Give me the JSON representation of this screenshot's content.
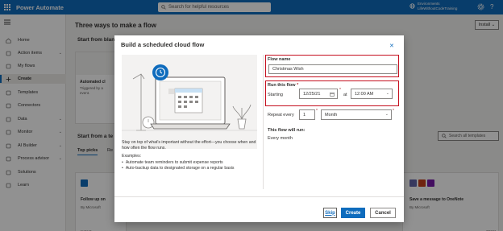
{
  "topbar": {
    "app_title": "Power Automate",
    "search_placeholder": "Search for helpful resources",
    "environment_label": "Environments",
    "environment_name": "LifeWithoutCodeTraining",
    "help": "?"
  },
  "sidebar": {
    "items": [
      {
        "label": "Home",
        "icon": "home-icon",
        "chevron": false
      },
      {
        "label": "Action items",
        "icon": "checklist-icon",
        "chevron": true
      },
      {
        "label": "My flows",
        "icon": "flows-icon",
        "chevron": false
      },
      {
        "label": "Create",
        "icon": "plus-icon",
        "chevron": false
      },
      {
        "label": "Templates",
        "icon": "templates-icon",
        "chevron": false
      },
      {
        "label": "Connectors",
        "icon": "connectors-icon",
        "chevron": false
      },
      {
        "label": "Data",
        "icon": "data-icon",
        "chevron": true
      },
      {
        "label": "Monitor",
        "icon": "monitor-icon",
        "chevron": true
      },
      {
        "label": "AI Builder",
        "icon": "ai-builder-icon",
        "chevron": true
      },
      {
        "label": "Process advisor",
        "icon": "process-advisor-icon",
        "chevron": true
      },
      {
        "label": "Solutions",
        "icon": "solutions-icon",
        "chevron": false
      },
      {
        "label": "Learn",
        "icon": "learn-icon",
        "chevron": false
      }
    ],
    "active_index": 3
  },
  "main": {
    "title": "Three ways to make a flow",
    "install_label": "Install",
    "start_blank_label": "Start from blan",
    "blank_cards": [
      {
        "title": "Automated cl",
        "subtitle": "Triggered by a\nevent."
      }
    ],
    "start_template_label": "Start from a te",
    "search_templates_placeholder": "Search all templates",
    "template_tabs": [
      "Top picks",
      "Re"
    ],
    "template_cards_left": [
      {
        "title": "Follow up on",
        "subtitle": "By Microsoft",
        "type": "Instant"
      }
    ],
    "template_cards_right": [
      {
        "title": "Save a message to OneNote",
        "subtitle": "By Microsoft",
        "count": "20191"
      }
    ]
  },
  "dialog": {
    "title": "Build a scheduled cloud flow",
    "description": "Stay on top of what's important without the effort—you choose when and how often the flow runs.",
    "examples_label": "Examples:",
    "examples": [
      "Automate team reminders to submit expense reports",
      "Auto-backup data to designated storage on a regular basis"
    ],
    "flow_name_label": "Flow name",
    "flow_name_value": "Christmas Wish",
    "run_label": "Run this flow",
    "required_mark": "*",
    "starting_label": "Starting",
    "start_date": "12/25/21",
    "at_label": "at",
    "start_time": "12:00 AM",
    "repeat_label": "Repeat every",
    "repeat_value": "1",
    "repeat_unit": "Month",
    "will_run_label": "This flow will run:",
    "will_run_value": "Every month",
    "skip_label": "Skip",
    "create_label": "Create",
    "cancel_label": "Cancel"
  },
  "colors": {
    "brand": "#0f6cbd",
    "highlight": "#c50f1f"
  }
}
